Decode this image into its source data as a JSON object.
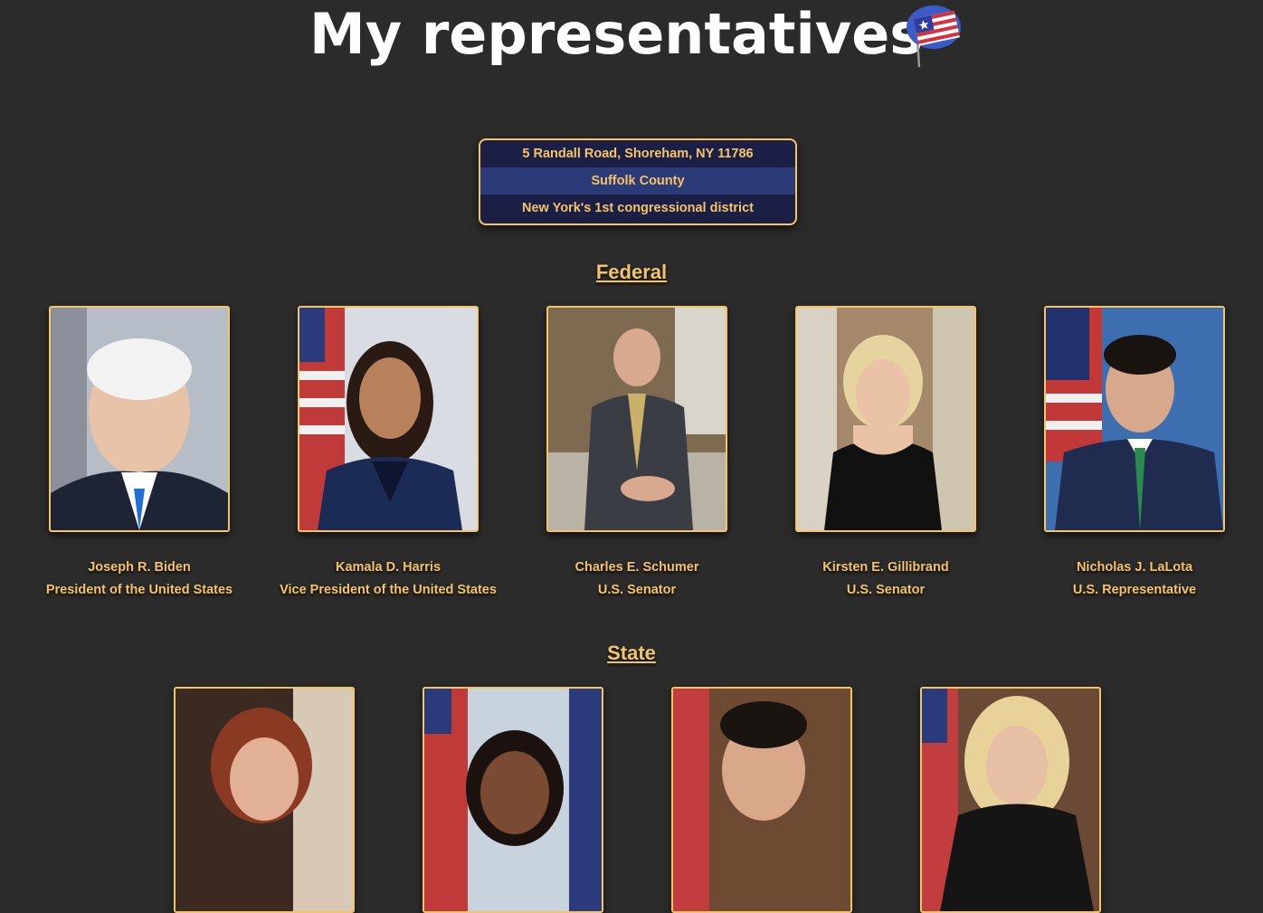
{
  "header": {
    "title": "My representatives",
    "flag_icon": "us-flag-balloon-icon"
  },
  "location": {
    "address": "5 Randall Road, Shoreham, NY 11786",
    "county": "Suffolk County",
    "district": "New York's 1st congressional district"
  },
  "federal": {
    "heading": "Federal",
    "reps": [
      {
        "name": "Joseph R. Biden",
        "office": "President of the United States"
      },
      {
        "name": "Kamala D. Harris",
        "office": "Vice President of the United States"
      },
      {
        "name": "Charles E. Schumer",
        "office": "U.S. Senator"
      },
      {
        "name": "Kirsten E. Gillibrand",
        "office": "U.S. Senator"
      },
      {
        "name": "Nicholas J. LaLota",
        "office": "U.S. Representative"
      }
    ]
  },
  "state": {
    "heading": "State"
  },
  "colors": {
    "background": "#2b2b2b",
    "accent": "#f3c567",
    "box_dark": "#1b1f45",
    "box_light": "#2c3a78"
  }
}
